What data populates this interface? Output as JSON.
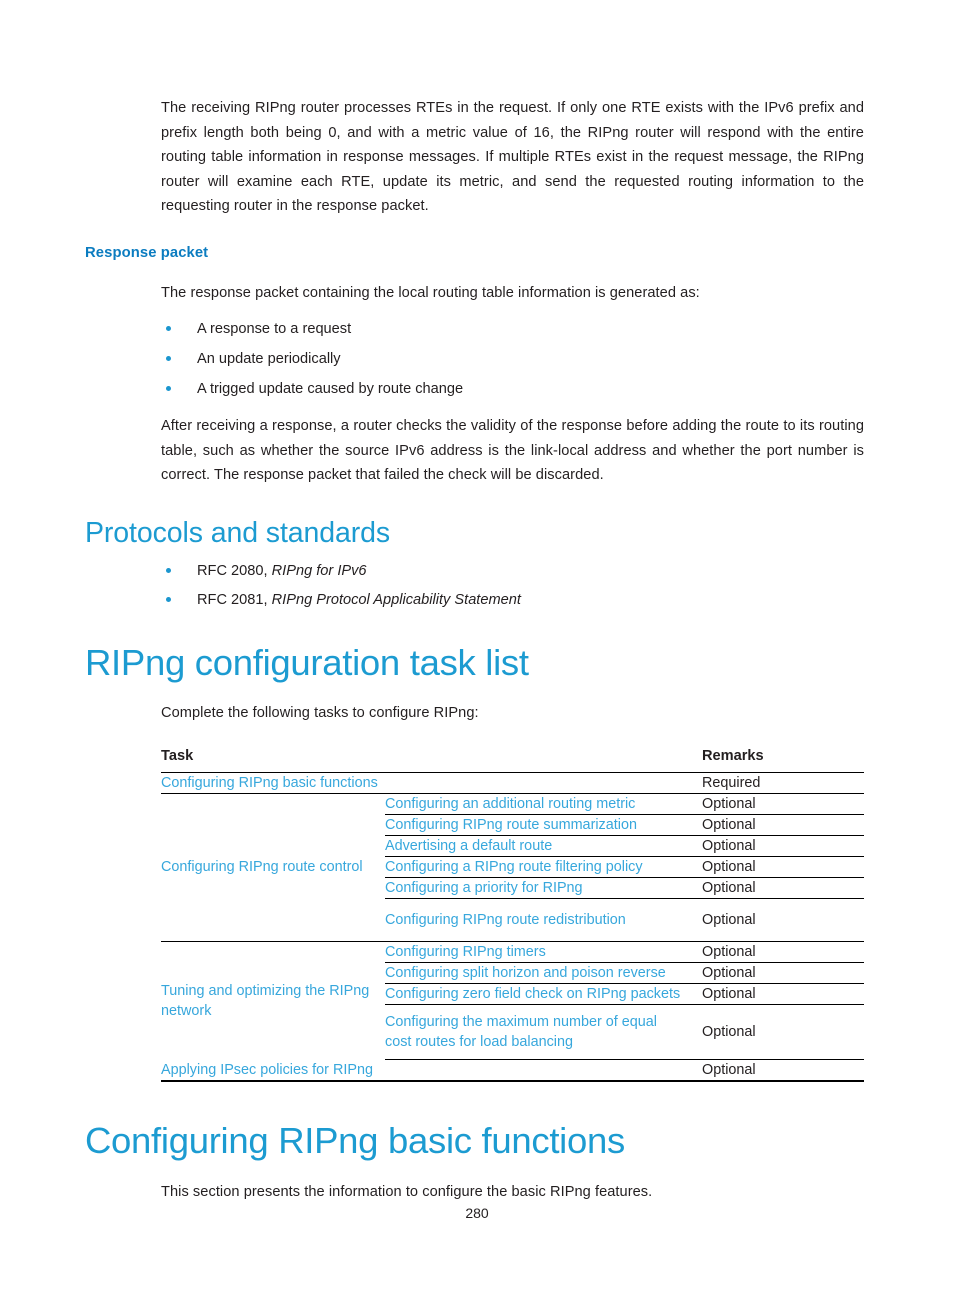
{
  "document": {
    "page_number": "280",
    "colors": {
      "heading_blue": "#1c9bd1",
      "subheading_blue": "#0b7cc0",
      "link_blue": "#37a7dc",
      "body_text": "#231f20",
      "bullet_blue": "#1b96cf"
    }
  },
  "intro_paragraph": "The receiving RIPng router processes RTEs in the request. If only one RTE exists with the IPv6 prefix and prefix length both being 0, and with a metric value of 16, the RIPng router will respond with the entire routing table information in response messages. If multiple RTEs exist in the request message, the RIPng router will examine each RTE, update its metric, and send the requested routing information to the requesting router in the response packet.",
  "response_packet": {
    "heading": "Response packet",
    "lead_in": "The response packet containing the local routing table information is generated as:",
    "bullets": [
      "A response to a request",
      "An update periodically",
      "A trigged update caused by route change"
    ],
    "closing_paragraph": "After receiving a response, a router checks the validity of the response before adding the route to its routing table, such as whether the source IPv6 address is the link-local address and whether the port number is correct. The response packet that failed the check will be discarded."
  },
  "protocols_and_standards": {
    "heading": "Protocols and standards",
    "items": [
      {
        "prefix": "RFC 2080, ",
        "title": "RIPng for IPv6"
      },
      {
        "prefix": "RFC 2081, ",
        "title": "RIPng Protocol Applicability Statement"
      }
    ]
  },
  "task_list_section": {
    "heading": "RIPng configuration task list",
    "lead_in": "Complete the following tasks to configure RIPng:",
    "table": {
      "headers": {
        "task": "Task",
        "remarks": "Remarks"
      },
      "rows": [
        {
          "type": "single",
          "task": "Configuring RIPng basic functions",
          "remarks": "Required"
        },
        {
          "type": "group",
          "group_label": "Configuring RIPng route control",
          "subrows": [
            {
              "task": "Configuring an additional routing metric",
              "remarks": "Optional"
            },
            {
              "task": "Configuring RIPng route summarization",
              "remarks": "Optional"
            },
            {
              "task": "Advertising a default route",
              "remarks": "Optional"
            },
            {
              "task": "Configuring a RIPng route filtering policy",
              "remarks": "Optional"
            },
            {
              "task": "Configuring a priority for RIPng",
              "remarks": "Optional"
            },
            {
              "task": "Configuring RIPng route redistribution",
              "remarks": "Optional"
            }
          ]
        },
        {
          "type": "group",
          "group_label": "Tuning and optimizing the RIPng network",
          "subrows": [
            {
              "task": "Configuring RIPng timers",
              "remarks": "Optional"
            },
            {
              "task": "Configuring split horizon and poison reverse",
              "remarks": "Optional"
            },
            {
              "task": "Configuring zero field check on RIPng packets",
              "remarks": "Optional"
            },
            {
              "task": "Configuring the maximum number of equal cost routes for load balancing",
              "remarks": "Optional"
            }
          ]
        },
        {
          "type": "single",
          "task": "Applying IPsec policies for RIPng",
          "remarks": "Optional"
        }
      ]
    }
  },
  "basic_functions_section": {
    "heading": "Configuring RIPng basic functions",
    "paragraph": "This section presents the information to configure the basic RIPng features."
  }
}
